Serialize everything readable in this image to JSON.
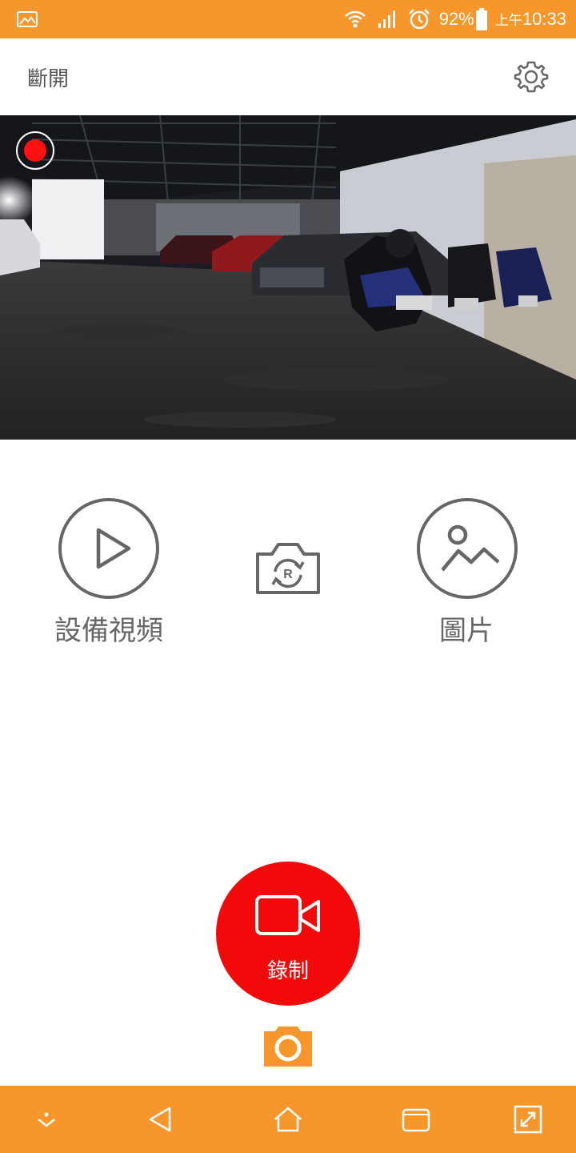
{
  "status_bar": {
    "left_icon": "image-icon",
    "icons": [
      "wifi-icon",
      "signal-icon",
      "alarm-icon",
      "battery-icon"
    ],
    "battery_percent": "92%",
    "ampm": "上午",
    "time": "10:33",
    "color": "#f7962b"
  },
  "header": {
    "disconnect_label": "斷開",
    "settings_icon": "gear-icon"
  },
  "camera": {
    "recording_indicator": "record-indicator-icon",
    "indicator_color": "#ff1010"
  },
  "actions": {
    "device_video_label": "設備視頻",
    "device_video_icon": "play-icon",
    "switch_camera_icon": "camera-flip-icon",
    "picture_label": "圖片",
    "picture_icon": "picture-icon"
  },
  "record": {
    "label": "錄制",
    "icon": "video-camera-icon",
    "color": "#f20a0a"
  },
  "snapshot": {
    "icon": "camera-icon",
    "color": "#f7962b"
  },
  "nav_bar": {
    "buttons": [
      "hide-bar-icon",
      "back-icon",
      "home-icon",
      "recents-icon",
      "expand-icon"
    ],
    "color": "#f7962b"
  }
}
